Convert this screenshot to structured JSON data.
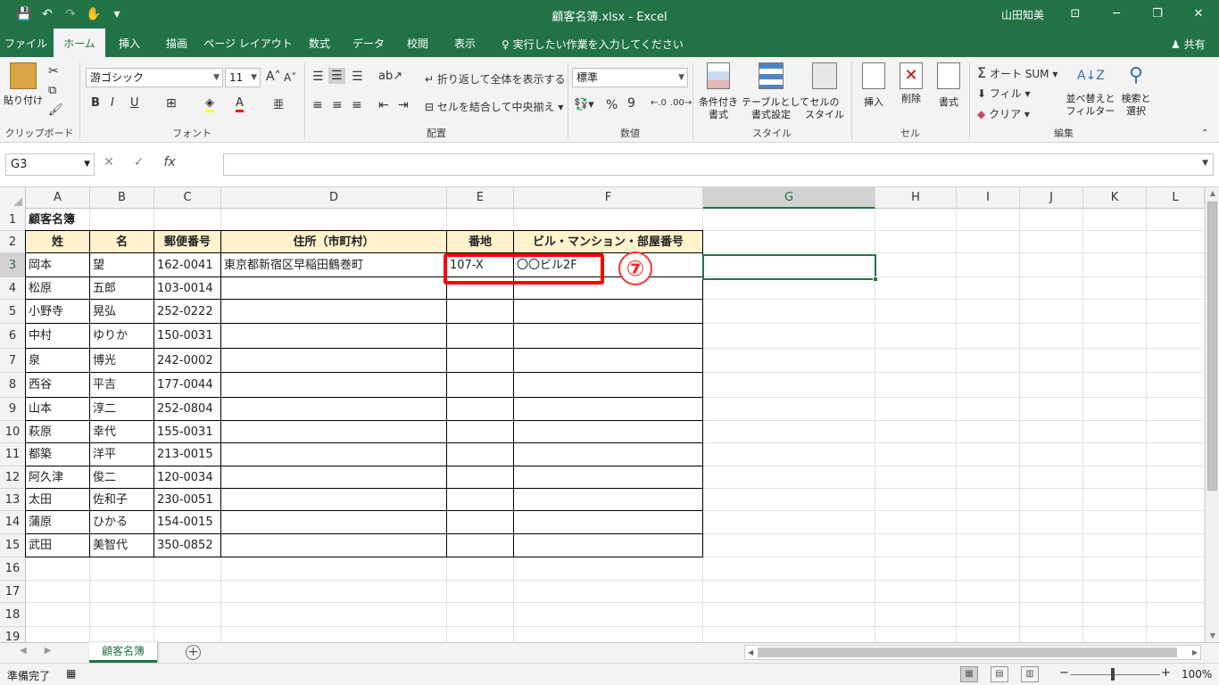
{
  "window": {
    "title": "顧客名簿.xlsx  -  Excel",
    "user": "山田知美",
    "minimize": "─",
    "restore": "❐",
    "close": "✕",
    "ribbon_display": "⊡"
  },
  "qat": {
    "save": "💾",
    "undo": "↶",
    "redo": "↷",
    "touch": "✋",
    "customize": "▾"
  },
  "tabs": [
    "ファイル",
    "ホーム",
    "挿入",
    "描画",
    "ページ レイアウト",
    "数式",
    "データ",
    "校閲",
    "表示"
  ],
  "active_tab": "ホーム",
  "tell_me": "♀ 実行したい作業を入力してください",
  "share": "♟ 共有",
  "ribbon": {
    "clipboard": {
      "paste": "貼り付け",
      "label": "クリップボード"
    },
    "font": {
      "name": "游ゴシック",
      "size": "11",
      "label": "フォント",
      "bold": "B",
      "italic": "I",
      "underline": "U"
    },
    "alignment": {
      "wrap": "折り返して全体を表示する",
      "merge": "セルを結合して中央揃え",
      "label": "配置"
    },
    "number": {
      "format": "標準",
      "percent": "%",
      "comma": "9",
      "label": "数値"
    },
    "styles": {
      "conditional": "条件付き\n書式",
      "table": "テーブルとして\n書式設定",
      "cell": "セルの\nスタイル",
      "label": "スタイル"
    },
    "cells": {
      "insert": "挿入",
      "delete": "削除",
      "format": "書式",
      "label": "セル"
    },
    "editing": {
      "autosum": "オート SUM",
      "fill": "フィル",
      "clear": "クリア",
      "sort": "並べ替えと\nフィルター",
      "find": "検索と\n選択",
      "label": "編集"
    }
  },
  "formula_bar": {
    "name_box": "G3",
    "formula": "",
    "cancel": "✕",
    "enter": "✓",
    "fx": "fx"
  },
  "columns": [
    "A",
    "B",
    "C",
    "D",
    "E",
    "F",
    "G",
    "H",
    "I",
    "J",
    "K",
    "L"
  ],
  "selected_column": "G",
  "selected_row": "3",
  "rows": [
    "1",
    "2",
    "3",
    "4",
    "5",
    "6",
    "7",
    "8",
    "9",
    "10",
    "11",
    "12",
    "13",
    "14",
    "15",
    "16",
    "17",
    "18",
    "19"
  ],
  "sheet": {
    "title": "顧客名簿",
    "headers": [
      "姓",
      "名",
      "郵便番号",
      "住所（市町村）",
      "番地",
      "ビル・マンション・部屋番号"
    ],
    "data": [
      [
        "岡本",
        "望",
        "162-0041",
        "東京都新宿区早稲田鶴巻町",
        "107-X",
        "〇〇ビル2F"
      ],
      [
        "松原",
        "五郎",
        "103-0014",
        "",
        "",
        ""
      ],
      [
        "小野寺",
        "晃弘",
        "252-0222",
        "",
        "",
        ""
      ],
      [
        "中村",
        "ゆりか",
        "150-0031",
        "",
        "",
        ""
      ],
      [
        "泉",
        "博光",
        "242-0002",
        "",
        "",
        ""
      ],
      [
        "西谷",
        "平吉",
        "177-0044",
        "",
        "",
        ""
      ],
      [
        "山本",
        "淳二",
        "252-0804",
        "",
        "",
        ""
      ],
      [
        "萩原",
        "幸代",
        "155-0031",
        "",
        "",
        ""
      ],
      [
        "都築",
        "洋平",
        "213-0015",
        "",
        "",
        ""
      ],
      [
        "阿久津",
        "俊二",
        "120-0034",
        "",
        "",
        ""
      ],
      [
        "太田",
        "佐和子",
        "230-0051",
        "",
        "",
        ""
      ],
      [
        "蒲原",
        "ひかる",
        "154-0015",
        "",
        "",
        ""
      ],
      [
        "武田",
        "美智代",
        "350-0852",
        "",
        "",
        ""
      ]
    ]
  },
  "annotation": {
    "step": "⑦",
    "color": "#ff0000"
  },
  "sheet_tab": "顧客名簿",
  "status": {
    "ready": "準備完了",
    "zoom": "100%",
    "minus": "−",
    "plus": "+"
  },
  "colors": {
    "excel_green": "#217346",
    "header_fill": "#fff2cc"
  }
}
